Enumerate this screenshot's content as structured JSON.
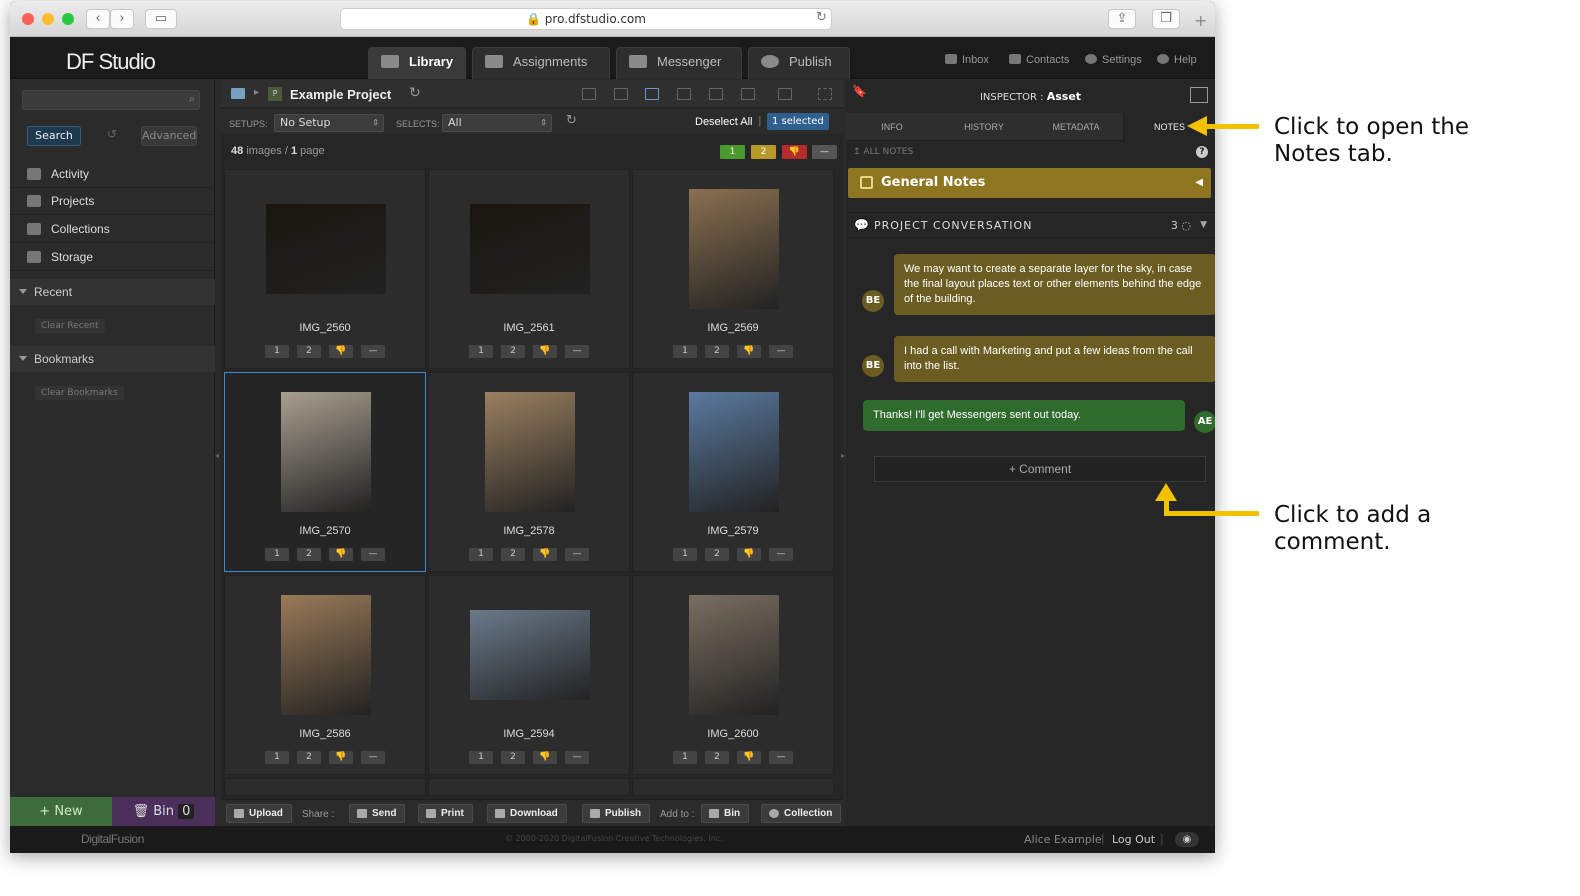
{
  "browser": {
    "url": "pro.dfstudio.com"
  },
  "app": {
    "logo": "DF Studio"
  },
  "main_tabs": [
    {
      "label": "Library",
      "active": true
    },
    {
      "label": "Assignments",
      "active": false
    },
    {
      "label": "Messenger",
      "active": false
    },
    {
      "label": "Publish",
      "active": false
    }
  ],
  "top_links": {
    "inbox": "Inbox",
    "contacts": "Contacts",
    "settings": "Settings",
    "help": "Help"
  },
  "sidebar": {
    "search_label": "Search",
    "advanced_label": "Advanced",
    "items": [
      {
        "label": "Activity",
        "icon": "activity-icon"
      },
      {
        "label": "Projects",
        "icon": "projects-icon"
      },
      {
        "label": "Collections",
        "icon": "collections-icon"
      },
      {
        "label": "Storage",
        "icon": "storage-icon"
      }
    ],
    "recent_label": "Recent",
    "clear_recent": "Clear Recent",
    "bookmarks_label": "Bookmarks",
    "clear_bookmarks": "Clear Bookmarks",
    "new_label": "+ New",
    "bin_label": "Bin",
    "bin_count": "0"
  },
  "project": {
    "breadcrumb_badge": "P",
    "name": "Example Project",
    "setups_label": "SETUPS:",
    "setups_value": "No Setup",
    "selects_label": "SELECTS:",
    "selects_value": "All",
    "deselect_all": "Deselect All",
    "selected_count": "1 selected",
    "images_count": "48",
    "images_label": "images",
    "pages_count": "1",
    "pages_label": "page",
    "rating_filters": [
      "1",
      "2",
      "👎",
      "—"
    ],
    "rating_colors": {
      "green": "#4a9a2e",
      "yellow": "#b89a2a",
      "red": "#b52a2a",
      "gray": "#555555"
    }
  },
  "images": [
    {
      "name": "IMG_2560",
      "selected": false
    },
    {
      "name": "IMG_2561",
      "selected": false
    },
    {
      "name": "IMG_2569",
      "selected": false
    },
    {
      "name": "IMG_2570",
      "selected": true
    },
    {
      "name": "IMG_2578",
      "selected": false
    },
    {
      "name": "IMG_2579",
      "selected": false
    },
    {
      "name": "IMG_2586",
      "selected": false
    },
    {
      "name": "IMG_2594",
      "selected": false
    },
    {
      "name": "IMG_2600",
      "selected": false
    }
  ],
  "rating_buttons": [
    "1",
    "2",
    "👎",
    "—"
  ],
  "bottom_bar": {
    "upload": "Upload",
    "share_label": "Share :",
    "send": "Send",
    "print": "Print",
    "download": "Download",
    "publish": "Publish",
    "add_to_label": "Add to :",
    "bin": "Bin",
    "collection": "Collection"
  },
  "inspector": {
    "title_prefix": "INSPECTOR :",
    "title_value": "Asset",
    "tabs": [
      "INFO",
      "HISTORY",
      "METADATA",
      "NOTES"
    ],
    "active_tab": "NOTES",
    "all_notes": "ALL NOTES",
    "general_notes": "General Notes",
    "conversation_label": "PROJECT CONVERSATION",
    "conversation_count": "3",
    "messages": [
      {
        "author": "BE",
        "text": "We may want to create a separate layer for the sky, in case the final layout places text or other elements behind the edge of the building.",
        "mine": false
      },
      {
        "author": "BE",
        "text": "I had a call with Marketing and put a few ideas from the call into the list.",
        "mine": false
      },
      {
        "author": "AE",
        "text": "Thanks! I'll get Messengers sent out today.",
        "mine": true
      }
    ],
    "comment_button": "+ Comment"
  },
  "footer": {
    "brand": "DigitalFusion",
    "copyright": "© 2000-2020 DigitalFusion Creative Technologies, Inc.",
    "user": "Alice Example",
    "logout": "Log Out"
  },
  "annotations": {
    "notes_tab": "Click to open the Notes tab.",
    "notes_tab_line1": "Click to open the",
    "notes_tab_line2": "Notes tab.",
    "comment_line1": "Click to add a",
    "comment_line2": "comment.",
    "arrow_color": "#f2c200"
  }
}
